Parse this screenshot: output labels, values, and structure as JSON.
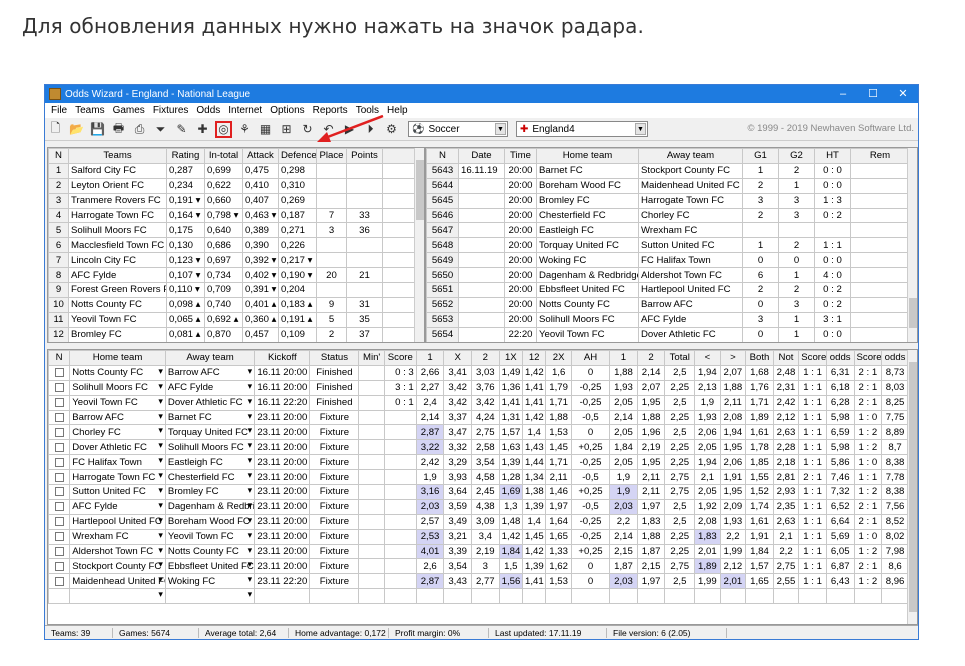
{
  "caption": "Для обновления данных нужно нажать на значок радара.",
  "window": {
    "title": "Odds Wizard - England - National League",
    "controls": [
      "–",
      "☐",
      "✕"
    ]
  },
  "menu": [
    "File",
    "Teams",
    "Games",
    "Fixtures",
    "Odds",
    "Internet",
    "Options",
    "Reports",
    "Tools",
    "Help"
  ],
  "toolbar": {
    "icons": [
      "new-icon",
      "open-icon",
      "save-icon",
      "print-icon",
      "report-icon",
      "filter-icon",
      "tools-icon",
      "add-icon",
      "radar-icon",
      "chart-icon",
      "calendar-icon",
      "stats-icon",
      "refresh-icon",
      "undo-icon",
      "play-icon",
      "forward-icon",
      "settings-icon"
    ],
    "sport": "Soccer",
    "league": "England4",
    "copyright": "© 1999 - 2019 Newhaven Software Ltd."
  },
  "teams_table": {
    "headers": [
      "N",
      "Teams",
      "Rating",
      "In-total",
      "Attack",
      "Defence",
      "Place",
      "Points"
    ],
    "rows": [
      [
        "1",
        "Salford City FC",
        "0,287",
        "0,699",
        "0,475",
        "0,298",
        "",
        ""
      ],
      [
        "2",
        "Leyton Orient FC",
        "0,234",
        "0,622",
        "0,410",
        "0,310",
        "",
        ""
      ],
      [
        "3",
        "Tranmere Rovers FC",
        "0,191 ▾",
        "0,660",
        "0,407",
        "0,269",
        "",
        ""
      ],
      [
        "4",
        "Harrogate Town FC",
        "0,164 ▾",
        "0,798 ▾",
        "0,463 ▾",
        "0,187",
        "7",
        "33"
      ],
      [
        "5",
        "Solihull Moors FC",
        "0,175",
        "0,640",
        "0,389",
        "0,271",
        "3",
        "36"
      ],
      [
        "6",
        "Macclesfield Town FC",
        "0,130",
        "0,686",
        "0,390",
        "0,226",
        "",
        ""
      ],
      [
        "7",
        "Lincoln City FC",
        "0,123 ▾",
        "0,697",
        "0,392 ▾",
        "0,217 ▾",
        "",
        ""
      ],
      [
        "8",
        "AFC Fylde",
        "0,107 ▾",
        "0,734",
        "0,402 ▾",
        "0,190 ▾",
        "20",
        "21"
      ],
      [
        "9",
        "Forest Green Rovers FC",
        "0,110 ▾",
        "0,709",
        "0,391 ▾",
        "0,204",
        "",
        ""
      ],
      [
        "10",
        "Notts County FC",
        "0,098 ▴",
        "0,740",
        "0,401 ▴",
        "0,183 ▴",
        "9",
        "31"
      ],
      [
        "11",
        "Yeovil Town FC",
        "0,065 ▴",
        "0,692 ▴",
        "0,360 ▴",
        "0,191 ▴",
        "5",
        "35"
      ],
      [
        "12",
        "Bromley FC",
        "0,081 ▴",
        "0,870",
        "0,457",
        "0,109",
        "2",
        "37"
      ]
    ]
  },
  "results_table": {
    "headers": [
      "N",
      "Date",
      "Time",
      "Home team",
      "Away team",
      "G1",
      "G2",
      "HT",
      "Rem"
    ],
    "rows": [
      [
        "5643",
        "16.11.19",
        "20:00",
        "Barnet FC",
        "Stockport County FC",
        "1",
        "2",
        "0 : 0",
        ""
      ],
      [
        "5644",
        "",
        "20:00",
        "Boreham Wood FC",
        "Maidenhead United FC",
        "2",
        "1",
        "0 : 0",
        ""
      ],
      [
        "5645",
        "",
        "20:00",
        "Bromley FC",
        "Harrogate Town FC",
        "3",
        "3",
        "1 : 3",
        ""
      ],
      [
        "5646",
        "",
        "20:00",
        "Chesterfield FC",
        "Chorley FC",
        "2",
        "3",
        "0 : 2",
        ""
      ],
      [
        "5647",
        "",
        "20:00",
        "Eastleigh FC",
        "Wrexham FC",
        "",
        "",
        "",
        ""
      ],
      [
        "5648",
        "",
        "20:00",
        "Torquay United FC",
        "Sutton United FC",
        "1",
        "2",
        "1 : 1",
        ""
      ],
      [
        "5649",
        "",
        "20:00",
        "Woking FC",
        "FC Halifax Town",
        "0",
        "0",
        "0 : 0",
        ""
      ],
      [
        "5650",
        "",
        "20:00",
        "Dagenham & Redbridge",
        "Aldershot Town FC",
        "6",
        "1",
        "4 : 0",
        ""
      ],
      [
        "5651",
        "",
        "20:00",
        "Ebbsfleet United FC",
        "Hartlepool United FC",
        "2",
        "2",
        "0 : 2",
        ""
      ],
      [
        "5652",
        "",
        "20:00",
        "Notts County FC",
        "Barrow AFC",
        "0",
        "3",
        "0 : 2",
        ""
      ],
      [
        "5653",
        "",
        "20:00",
        "Solihull Moors FC",
        "AFC Fylde",
        "3",
        "1",
        "3 : 1",
        ""
      ],
      [
        "5654",
        "",
        "22:20",
        "Yeovil Town FC",
        "Dover Athletic FC",
        "0",
        "1",
        "0 : 0",
        ""
      ]
    ]
  },
  "fixtures_table": {
    "headers": [
      "N",
      "Home team",
      "Away team",
      "Kickoff",
      "Status",
      "Min'",
      "Score",
      "1",
      "X",
      "2",
      "1X",
      "12",
      "2X",
      "AH",
      "1",
      "2",
      "Total",
      "<",
      ">",
      "Both",
      "Not",
      "Score",
      "odds",
      "Score",
      "odds"
    ],
    "rows": [
      [
        "Notts County FC",
        "Barrow AFC",
        "16.11 20:00",
        "Finished",
        "",
        "0 : 3",
        "2,66",
        "3,41",
        "3,03",
        "1,49",
        "1,42",
        "1,6",
        "0",
        "1,88",
        "2,14",
        "2,5",
        "1,94",
        "2,07",
        "1,68",
        "2,48",
        "1 : 1",
        "6,31",
        "2 : 1",
        "8,73"
      ],
      [
        "Solihull Moors FC",
        "AFC Fylde",
        "16.11 20:00",
        "Finished",
        "",
        "3 : 1",
        "2,27",
        "3,42",
        "3,76",
        "1,36",
        "1,41",
        "1,79",
        "-0,25",
        "1,93",
        "2,07",
        "2,25",
        "2,13",
        "1,88",
        "1,76",
        "2,31",
        "1 : 1",
        "6,18",
        "2 : 1",
        "8,03"
      ],
      [
        "Yeovil Town FC",
        "Dover Athletic FC",
        "16.11 22:20",
        "Finished",
        "",
        "0 : 1",
        "2,4",
        "3,42",
        "3,42",
        "1,41",
        "1,41",
        "1,71",
        "-0,25",
        "2,05",
        "1,95",
        "2,5",
        "1,9",
        "2,11",
        "1,71",
        "2,42",
        "1 : 1",
        "6,28",
        "2 : 1",
        "8,25"
      ],
      [
        "Barrow AFC",
        "Barnet FC",
        "23.11 20:00",
        "Fixture",
        "",
        "",
        "2,14",
        "3,37",
        "4,24",
        "1,31",
        "1,42",
        "1,88",
        "-0,5",
        "2,14",
        "1,88",
        "2,25",
        "1,93",
        "2,08",
        "1,89",
        "2,12",
        "1 : 1",
        "5,98",
        "1 : 0",
        "7,75"
      ],
      [
        "Chorley FC",
        "Torquay United FC",
        "23.11 20:00",
        "Fixture",
        "",
        "",
        "2,87",
        "3,47",
        "2,75",
        "1,57",
        "1,4",
        "1,53",
        "0",
        "2,05",
        "1,96",
        "2,5",
        "2,06",
        "1,94",
        "1,61",
        "2,63",
        "1 : 1",
        "6,59",
        "1 : 2",
        "8,89"
      ],
      [
        "Dover Athletic FC",
        "Solihull Moors FC",
        "23.11 20:00",
        "Fixture",
        "",
        "",
        "3,22",
        "3,32",
        "2,58",
        "1,63",
        "1,43",
        "1,45",
        "+0,25",
        "1,84",
        "2,19",
        "2,25",
        "2,05",
        "1,95",
        "1,78",
        "2,28",
        "1 : 1",
        "5,98",
        "1 : 2",
        "8,7"
      ],
      [
        "FC Halifax Town",
        "Eastleigh FC",
        "23.11 20:00",
        "Fixture",
        "",
        "",
        "2,42",
        "3,29",
        "3,54",
        "1,39",
        "1,44",
        "1,71",
        "-0,25",
        "2,05",
        "1,95",
        "2,25",
        "1,94",
        "2,06",
        "1,85",
        "2,18",
        "1 : 1",
        "5,86",
        "1 : 0",
        "8,38"
      ],
      [
        "Harrogate Town FC",
        "Chesterfield FC",
        "23.11 20:00",
        "Fixture",
        "",
        "",
        "1,9",
        "3,93",
        "4,58",
        "1,28",
        "1,34",
        "2,11",
        "-0,5",
        "1,9",
        "2,11",
        "2,75",
        "2,1",
        "1,91",
        "1,55",
        "2,81",
        "2 : 1",
        "7,46",
        "1 : 1",
        "7,78"
      ],
      [
        "Sutton United FC",
        "Bromley FC",
        "23.11 20:00",
        "Fixture",
        "",
        "",
        "3,16",
        "3,64",
        "2,45",
        "1,69",
        "1,38",
        "1,46",
        "+0,25",
        "1,9",
        "2,11",
        "2,75",
        "2,05",
        "1,95",
        "1,52",
        "2,93",
        "1 : 1",
        "7,32",
        "1 : 2",
        "8,38"
      ],
      [
        "AFC Fylde",
        "Dagenham & Redbridge",
        "23.11 20:00",
        "Fixture",
        "",
        "",
        "2,03",
        "3,59",
        "4,38",
        "1,3",
        "1,39",
        "1,97",
        "-0,5",
        "2,03",
        "1,97",
        "2,5",
        "1,92",
        "2,09",
        "1,74",
        "2,35",
        "1 : 1",
        "6,52",
        "2 : 1",
        "7,56"
      ],
      [
        "Hartlepool United FC",
        "Boreham Wood FC",
        "23.11 20:00",
        "Fixture",
        "",
        "",
        "2,57",
        "3,49",
        "3,09",
        "1,48",
        "1,4",
        "1,64",
        "-0,25",
        "2,2",
        "1,83",
        "2,5",
        "2,08",
        "1,93",
        "1,61",
        "2,63",
        "1 : 1",
        "6,64",
        "2 : 1",
        "8,52"
      ],
      [
        "Wrexham FC",
        "Yeovil Town FC",
        "23.11 20:00",
        "Fixture",
        "",
        "",
        "2,53",
        "3,21",
        "3,4",
        "1,42",
        "1,45",
        "1,65",
        "-0,25",
        "2,14",
        "1,88",
        "2,25",
        "1,83",
        "2,2",
        "1,91",
        "2,1",
        "1 : 1",
        "5,69",
        "1 : 0",
        "8,02"
      ],
      [
        "Aldershot Town FC",
        "Notts County FC",
        "23.11 20:00",
        "Fixture",
        "",
        "",
        "4,01",
        "3,39",
        "2,19",
        "1,84",
        "1,42",
        "1,33",
        "+0,25",
        "2,15",
        "1,87",
        "2,25",
        "2,01",
        "1,99",
        "1,84",
        "2,2",
        "1 : 1",
        "6,05",
        "1 : 2",
        "7,98"
      ],
      [
        "Stockport County FC",
        "Ebbsfleet United FC",
        "23.11 20:00",
        "Fixture",
        "",
        "",
        "2,6",
        "3,54",
        "3",
        "1,5",
        "1,39",
        "1,62",
        "0",
        "1,87",
        "2,15",
        "2,75",
        "1,89",
        "2,12",
        "1,57",
        "2,75",
        "1 : 1",
        "6,87",
        "2 : 1",
        "8,6"
      ],
      [
        "Maidenhead United FC",
        "Woking FC",
        "23.11 22:20",
        "Fixture",
        "",
        "",
        "2,87",
        "3,43",
        "2,77",
        "1,56",
        "1,41",
        "1,53",
        "0",
        "2,03",
        "1,97",
        "2,5",
        "1,99",
        "2,01",
        "1,65",
        "2,55",
        "1 : 1",
        "6,43",
        "1 : 2",
        "8,96"
      ]
    ]
  },
  "status": [
    "Teams: 39",
    "Games: 5674",
    "Average total: 2,64",
    "Home advantage: 0,172",
    "Profit margin: 0%",
    "Last updated: 17.11.19",
    "File version: 6 (2.05)"
  ],
  "colors": {
    "titlebar": "#1e7be0",
    "highlight_cell": "#d4d4f4",
    "annotation": "#e02020"
  }
}
